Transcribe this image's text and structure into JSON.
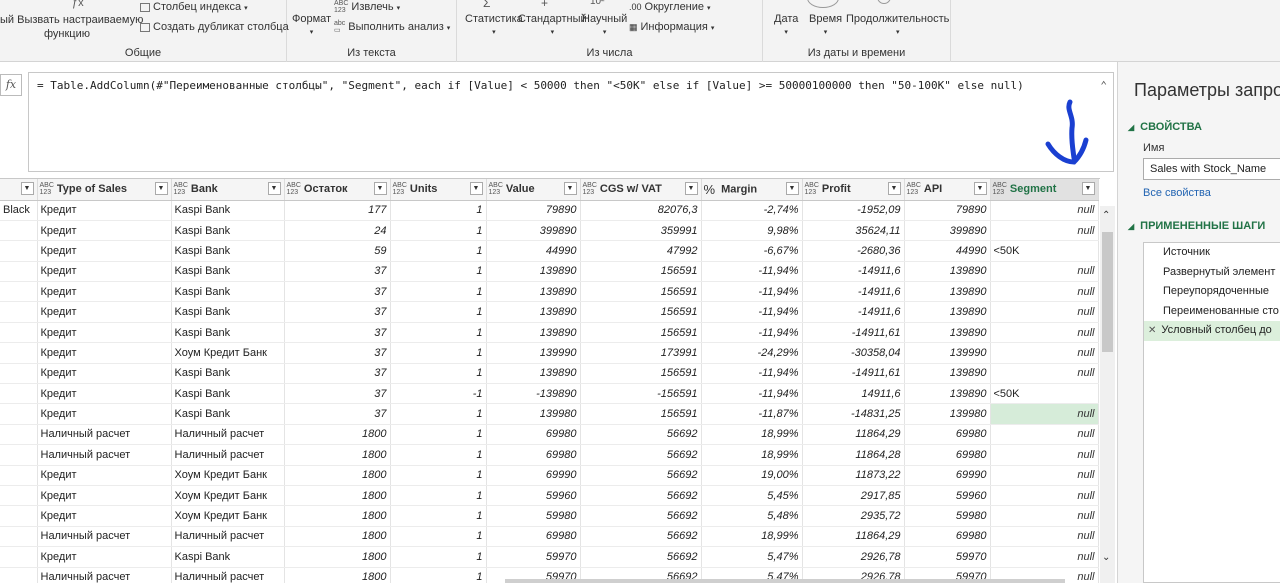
{
  "ribbon": {
    "general": {
      "invoke_label": "ый Вызвать настраиваемую",
      "invoke_label2": "функцию",
      "index_label": "Столбец индекса",
      "dup_label": "Создать дубликат столбца",
      "group_label": "Общие"
    },
    "text": {
      "format_label": "Формат",
      "extract_label": "Извлечь",
      "parse_label": "Выполнить анализ",
      "group_label": "Из текста"
    },
    "number": {
      "stats_label": "Статистика",
      "standard_label": "Стандартный",
      "sci_label": "Научный",
      "round_label": "Округление",
      "info_label": "Информация",
      "group_label": "Из числа"
    },
    "datetime": {
      "date_label": "Дата",
      "time_label": "Время",
      "duration_label": "Продолжительность",
      "group_label": "Из даты и времени"
    }
  },
  "formula": {
    "fx": "fx",
    "text": "= Table.AddColumn(#\"Переименованные столбцы\", \"Segment\", each if [Value] < 50000 then \"<50K\" else if [Value] >= 50000100000 then \"50-100K\" else null)"
  },
  "columns": [
    {
      "type": "",
      "name": ""
    },
    {
      "type": "ABC",
      "name": "Type of Sales"
    },
    {
      "type": "ABC",
      "name": "Bank"
    },
    {
      "type": "ABC",
      "name": "Остаток"
    },
    {
      "type": "ABC",
      "name": "Units"
    },
    {
      "type": "ABC",
      "name": "Value"
    },
    {
      "type": "ABC",
      "name": "CGS w/ VAT"
    },
    {
      "type": "%",
      "name": "Margin"
    },
    {
      "type": "ABC",
      "name": "Profit"
    },
    {
      "type": "ABC",
      "name": "API"
    },
    {
      "type": "ABC",
      "name": "Segment"
    }
  ],
  "type_sub": "123",
  "rows": [
    [
      "Black",
      "Кредит",
      "Kaspi Bank",
      "177",
      "1",
      "79890",
      "82076,3",
      "-2,74%",
      "-1952,09",
      "79890",
      "null"
    ],
    [
      "",
      "Кредит",
      "Kaspi Bank",
      "24",
      "1",
      "399890",
      "359991",
      "9,98%",
      "35624,11",
      "399890",
      "null"
    ],
    [
      "",
      "Кредит",
      "Kaspi Bank",
      "59",
      "1",
      "44990",
      "47992",
      "-6,67%",
      "-2680,36",
      "44990",
      "<50K"
    ],
    [
      "",
      "Кредит",
      "Kaspi Bank",
      "37",
      "1",
      "139890",
      "156591",
      "-11,94%",
      "-14911,6",
      "139890",
      "null"
    ],
    [
      "",
      "Кредит",
      "Kaspi Bank",
      "37",
      "1",
      "139890",
      "156591",
      "-11,94%",
      "-14911,6",
      "139890",
      "null"
    ],
    [
      "",
      "Кредит",
      "Kaspi Bank",
      "37",
      "1",
      "139890",
      "156591",
      "-11,94%",
      "-14911,6",
      "139890",
      "null"
    ],
    [
      "",
      "Кредит",
      "Kaspi Bank",
      "37",
      "1",
      "139890",
      "156591",
      "-11,94%",
      "-14911,61",
      "139890",
      "null"
    ],
    [
      "",
      "Кредит",
      "Хоум Кредит Банк",
      "37",
      "1",
      "139990",
      "173991",
      "-24,29%",
      "-30358,04",
      "139990",
      "null"
    ],
    [
      "",
      "Кредит",
      "Kaspi Bank",
      "37",
      "1",
      "139890",
      "156591",
      "-11,94%",
      "-14911,61",
      "139890",
      "null"
    ],
    [
      "",
      "Кредит",
      "Kaspi Bank",
      "37",
      "-1",
      "-139890",
      "-156591",
      "-11,94%",
      "14911,6",
      "139890",
      "<50K"
    ],
    [
      "",
      "Кредит",
      "Kaspi Bank",
      "37",
      "1",
      "139980",
      "156591",
      "-11,87%",
      "-14831,25",
      "139980",
      "null"
    ],
    [
      "",
      "Наличный расчет",
      "Наличный расчет",
      "1800",
      "1",
      "69980",
      "56692",
      "18,99%",
      "11864,29",
      "69980",
      "null"
    ],
    [
      "",
      "Наличный расчет",
      "Наличный расчет",
      "1800",
      "1",
      "69980",
      "56692",
      "18,99%",
      "11864,28",
      "69980",
      "null"
    ],
    [
      "",
      "Кредит",
      "Хоум Кредит Банк",
      "1800",
      "1",
      "69990",
      "56692",
      "19,00%",
      "11873,22",
      "69990",
      "null"
    ],
    [
      "",
      "Кредит",
      "Хоум Кредит Банк",
      "1800",
      "1",
      "59960",
      "56692",
      "5,45%",
      "2917,85",
      "59960",
      "null"
    ],
    [
      "",
      "Кредит",
      "Хоум Кредит Банк",
      "1800",
      "1",
      "59980",
      "56692",
      "5,48%",
      "2935,72",
      "59980",
      "null"
    ],
    [
      "",
      "Наличный расчет",
      "Наличный расчет",
      "1800",
      "1",
      "69980",
      "56692",
      "18,99%",
      "11864,29",
      "69980",
      "null"
    ],
    [
      "",
      "Кредит",
      "Kaspi Bank",
      "1800",
      "1",
      "59970",
      "56692",
      "5,47%",
      "2926,78",
      "59970",
      "null"
    ],
    [
      "",
      "Наличный расчет",
      "Наличный расчет",
      "1800",
      "1",
      "59970",
      "56692",
      "5,47%",
      "2926,78",
      "59970",
      "null"
    ]
  ],
  "highlight_row": 10,
  "panel": {
    "title": "Параметры запро",
    "props_section": "СВОЙСТВА",
    "name_label": "Имя",
    "name_value": "Sales with Stock_Name",
    "all_props_link": "Все свойства",
    "steps_section": "ПРИМЕНЕННЫЕ ШАГИ",
    "steps": [
      "Источник",
      "Развернутый элемент",
      "Переупорядоченные",
      "Переименованные сто",
      "Условный столбец до"
    ],
    "selected_step": 4
  },
  "colors": {
    "accent_green": "#217346",
    "arrow_blue": "#1a3fd1",
    "link_blue": "#2264b2",
    "highlight": "#d6ecd9"
  },
  "icons": {
    "fx": "function-icon",
    "arrow": "annotation-arrow-icon",
    "collapse": "chevron-up-icon",
    "delete_step": "close-icon"
  }
}
